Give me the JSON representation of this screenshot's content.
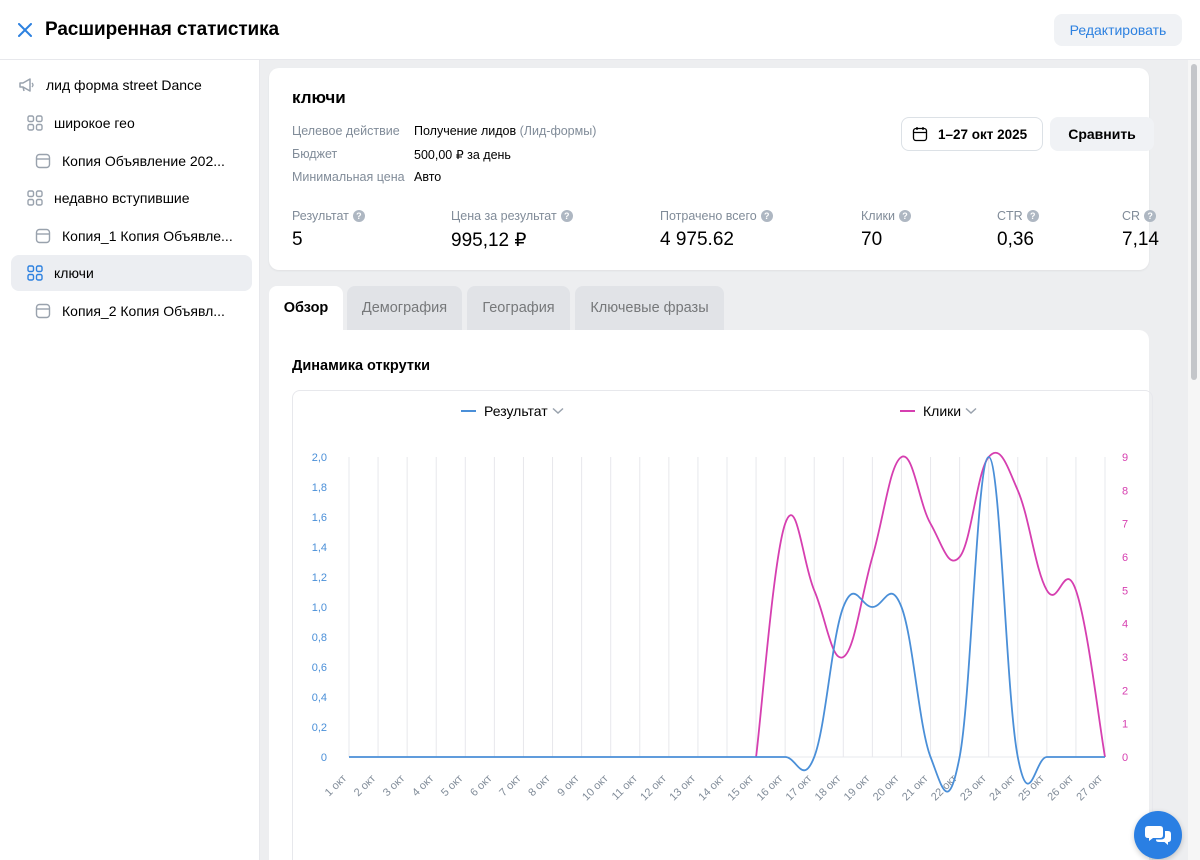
{
  "header": {
    "title": "Расширенная статистика",
    "edit_label": "Редактировать"
  },
  "sidebar": {
    "items": [
      {
        "label": "лид форма street Dance",
        "icon": "megaphone-icon"
      },
      {
        "label": "широкое гео",
        "icon": "grid-icon"
      },
      {
        "label": "Копия Объявление 202...",
        "icon": "ad-card-icon"
      },
      {
        "label": "недавно вступившие",
        "icon": "grid-icon"
      },
      {
        "label": "Копия_1 Копия Объявле...",
        "icon": "ad-card-icon"
      },
      {
        "label": "ключи",
        "icon": "grid-icon",
        "active": true
      },
      {
        "label": "Копия_2 Копия Объявл...",
        "icon": "ad-card-icon"
      }
    ]
  },
  "summary": {
    "title": "ключи",
    "target_label": "Целевое действие",
    "target_value": "Получение лидов",
    "target_note": "(Лид-формы)",
    "budget_label": "Бюджет",
    "budget_value": "500,00 ₽ за день",
    "min_price_label": "Минимальная цена",
    "min_price_value": "Авто",
    "date_range": "1–27 окт 2025",
    "compare_label": "Сравнить",
    "stats": [
      {
        "label": "Результат",
        "value": "5"
      },
      {
        "label": "Цена за результат",
        "value": "995,12 ₽"
      },
      {
        "label": "Потрачено всего",
        "value": "4 975.62"
      },
      {
        "label": "Клики",
        "value": "70"
      },
      {
        "label": "CTR",
        "value": "0,36"
      },
      {
        "label": "CR",
        "value": "7,14"
      }
    ]
  },
  "tabs": [
    "Обзор",
    "Демография",
    "География",
    "Ключевые фразы"
  ],
  "panel": {
    "title": "Динамика открутки"
  },
  "colors": {
    "accent": "#2d81e0",
    "series_result": "#4a8fd8",
    "series_clicks": "#d63fb0"
  },
  "chart_data": {
    "type": "line",
    "categories": [
      "1 окт",
      "2 окт",
      "3 окт",
      "4 окт",
      "5 окт",
      "6 окт",
      "7 окт",
      "8 окт",
      "9 окт",
      "10 окт",
      "11 окт",
      "12 окт",
      "13 окт",
      "14 окт",
      "15 окт",
      "16 окт",
      "17 окт",
      "18 окт",
      "19 окт",
      "20 окт",
      "21 окт",
      "22 окт",
      "23 окт",
      "24 окт",
      "25 окт",
      "26 окт",
      "27 окт"
    ],
    "series": [
      {
        "name": "Результат",
        "axis": "left",
        "values": [
          0,
          0,
          0,
          0,
          0,
          0,
          0,
          0,
          0,
          0,
          0,
          0,
          0,
          0,
          0,
          0,
          0,
          1,
          1,
          1,
          0,
          0,
          2,
          0,
          0,
          0,
          0
        ]
      },
      {
        "name": "Клики",
        "axis": "right",
        "values": [
          0,
          0,
          0,
          0,
          0,
          0,
          0,
          0,
          0,
          0,
          0,
          0,
          0,
          0,
          0,
          7,
          5,
          3,
          6,
          9,
          7,
          6,
          9,
          8,
          5,
          5,
          0
        ]
      }
    ],
    "y_left": {
      "ticks": [
        "0",
        "0,2",
        "0,4",
        "0,6",
        "0,8",
        "1,0",
        "1,2",
        "1,4",
        "1,6",
        "1,8",
        "2,0"
      ],
      "min": 0,
      "max": 2
    },
    "y_right": {
      "ticks": [
        "0",
        "1",
        "2",
        "3",
        "4",
        "5",
        "6",
        "7",
        "8",
        "9"
      ],
      "min": 0,
      "max": 9
    },
    "grid": true,
    "legend_position": "top"
  }
}
